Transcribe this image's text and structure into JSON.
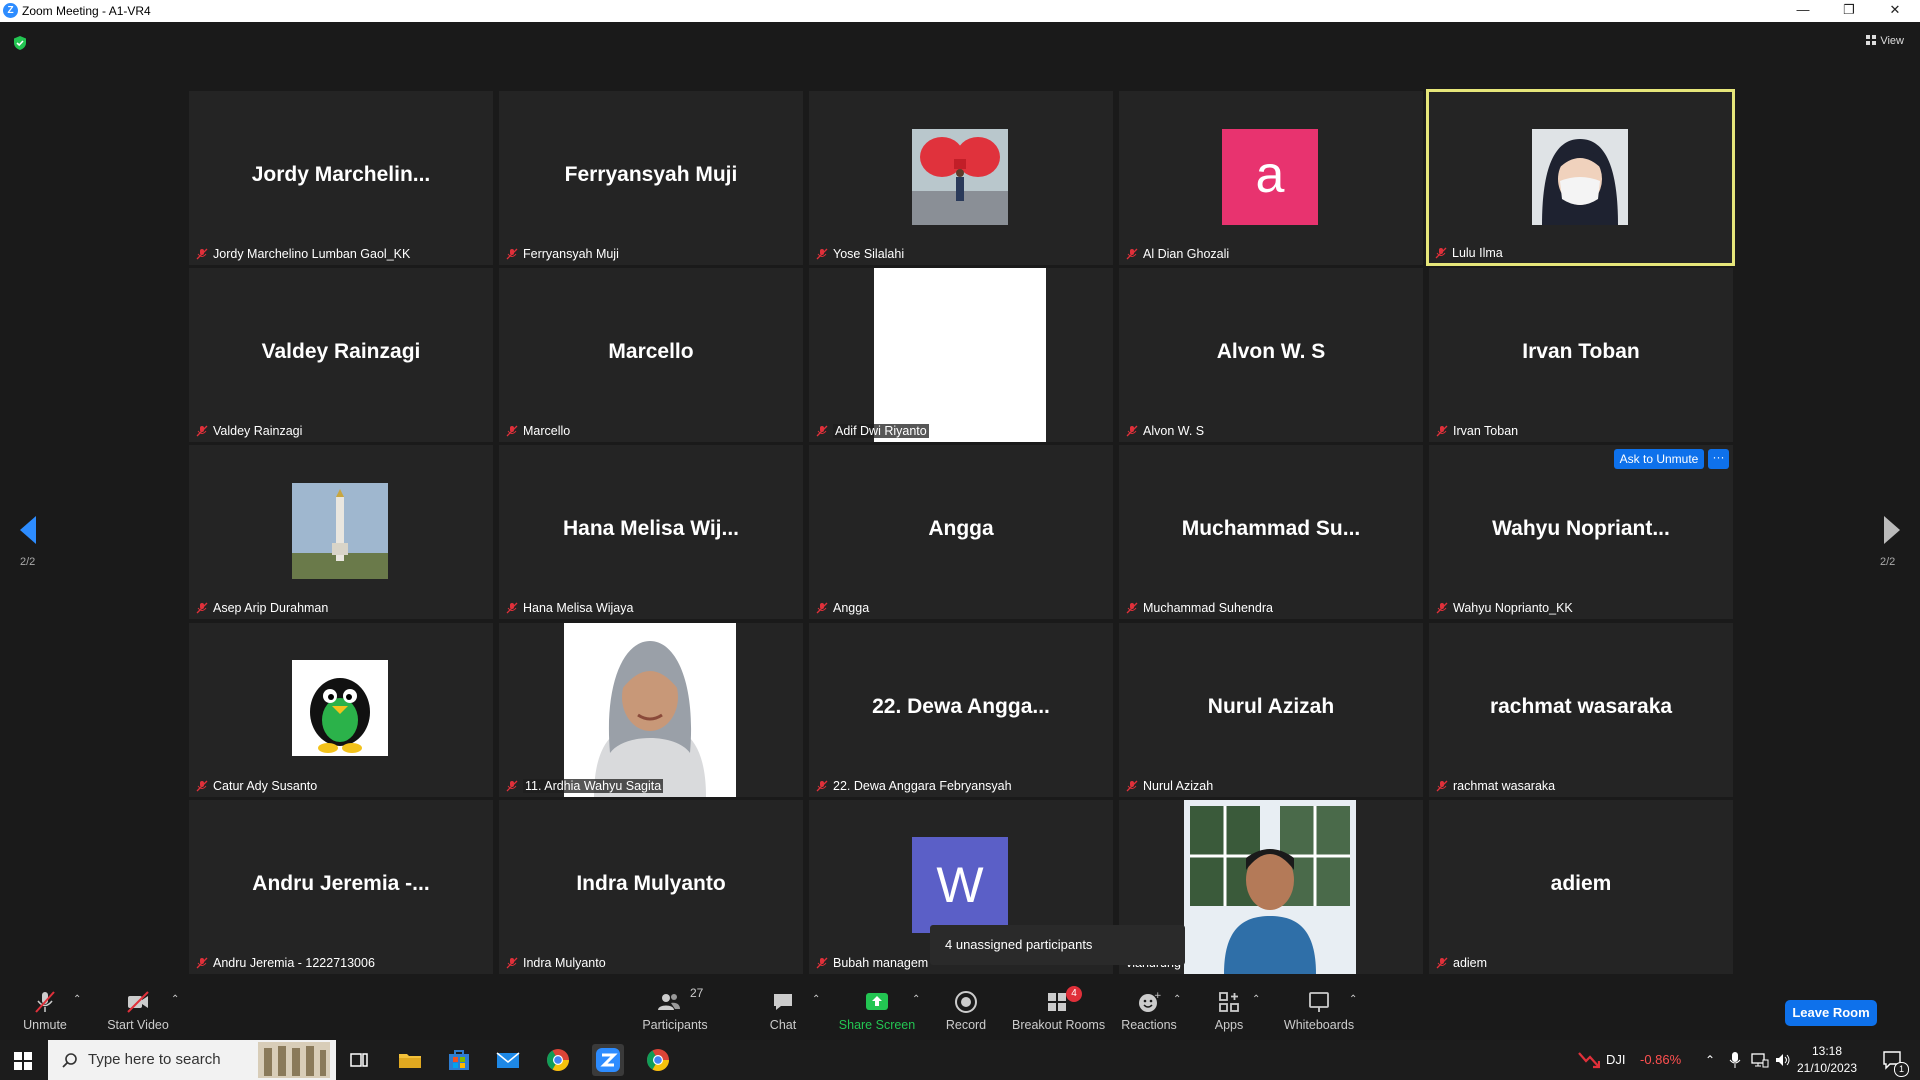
{
  "window": {
    "title": "Zoom Meeting - A1-VR4",
    "logo_letter": "Z"
  },
  "view_button": {
    "label": "View"
  },
  "pagination": {
    "left_label": "2/2",
    "right_label": "2/2"
  },
  "tiles": [
    {
      "big": "Jordy  Marchelin...",
      "tag": "Jordy Marchelino Lumban Gaol_KK"
    },
    {
      "big": "Ferryansyah Muji",
      "tag": "Ferryansyah Muji"
    },
    {
      "big": "",
      "tag": "Yose Silalahi"
    },
    {
      "big": "",
      "tag": "Al Dian Ghozali",
      "avatar_letter": "a"
    },
    {
      "big": "",
      "tag": "Lulu Ilma"
    },
    {
      "big": "Valdey Rainzagi",
      "tag": "Valdey Rainzagi"
    },
    {
      "big": "Marcello",
      "tag": "Marcello"
    },
    {
      "big": "",
      "tag": "Adif Dwi Riyanto"
    },
    {
      "big": "Alvon W. S",
      "tag": "Alvon W. S"
    },
    {
      "big": "Irvan Toban",
      "tag": "Irvan Toban"
    },
    {
      "big": "",
      "tag": "Asep Arip Durahman"
    },
    {
      "big": "Hana Melisa Wij...",
      "tag": "Hana Melisa Wijaya"
    },
    {
      "big": "Angga",
      "tag": "Angga"
    },
    {
      "big": "Muchammad  Su...",
      "tag": "Muchammad Suhendra"
    },
    {
      "big": "Wahyu  Nopriant...",
      "tag": "Wahyu Noprianto_KK"
    },
    {
      "big": "",
      "tag": "Catur Ady Susanto"
    },
    {
      "big": "",
      "tag": "11. Ardhia Wahyu Sagita"
    },
    {
      "big": "22. Dewa Angga...",
      "tag": "22. Dewa Anggara Febryansyah"
    },
    {
      "big": "Nurul Azizah",
      "tag": "Nurul Azizah"
    },
    {
      "big": "rachmat wasaraka",
      "tag": "rachmat wasaraka"
    },
    {
      "big": "Andru Jeremia -...",
      "tag": "Andru Jeremia - 1222713006"
    },
    {
      "big": "Indra Mulyanto",
      "tag": "Indra Mulyanto"
    },
    {
      "big": "",
      "tag": "Bubah managem",
      "avatar_letter": "W"
    },
    {
      "big": "",
      "tag": "vlanurung"
    },
    {
      "big": "adiem",
      "tag": "adiem"
    }
  ],
  "tile_actions": {
    "ask_to_unmute": "Ask to Unmute",
    "more": "···"
  },
  "tooltip": {
    "text": "4 unassigned participants"
  },
  "toolbar": {
    "unmute": "Unmute",
    "start_video": "Start Video",
    "participants": "Participants",
    "participants_count": "27",
    "chat": "Chat",
    "share_screen": "Share Screen",
    "record": "Record",
    "breakout_rooms": "Breakout Rooms",
    "breakout_badge": "4",
    "reactions": "Reactions",
    "apps": "Apps",
    "whiteboards": "Whiteboards",
    "leave_room": "Leave Room"
  },
  "taskbar": {
    "search_placeholder": "Type here to search",
    "stock_name": "DJI",
    "stock_change": "-0.86%",
    "time": "13:18",
    "date": "21/10/2023",
    "notification_count": "1"
  },
  "colors": {
    "zoom_blue": "#0e71eb",
    "active_speaker": "#e6e67a",
    "share_green": "#23c552",
    "muted_red": "#e0303a",
    "avatar_pink": "#e8336f",
    "avatar_purple": "#5b5fc7",
    "stock_red": "#ff5050"
  }
}
